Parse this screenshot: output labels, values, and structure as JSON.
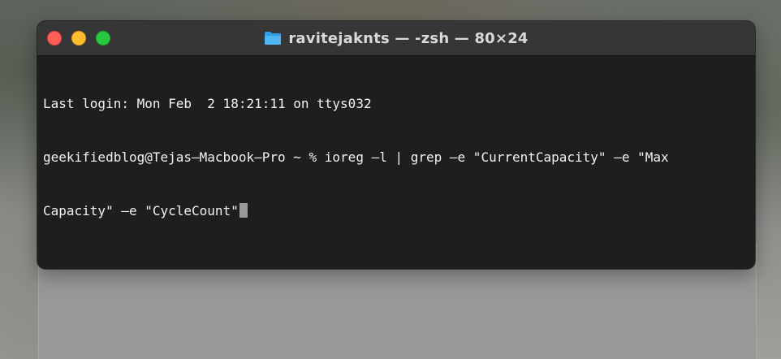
{
  "window": {
    "title": "ravitejaknts — -zsh — 80×24",
    "title_icon": "folder-icon",
    "traffic_lights": {
      "close_color": "#ff5f57",
      "minimize_color": "#febc2e",
      "zoom_color": "#28c840"
    }
  },
  "terminal": {
    "background": "#1e1e1e",
    "lines": [
      "Last login: Mon Feb  2 18:21:11 on ttys032",
      "geekifiedblog@Tejas—Macbook—Pro ~ % ioreg —l | grep —e \"CurrentCapacity\" —e \"Max",
      "Capacity\" —e \"CycleCount\""
    ]
  }
}
